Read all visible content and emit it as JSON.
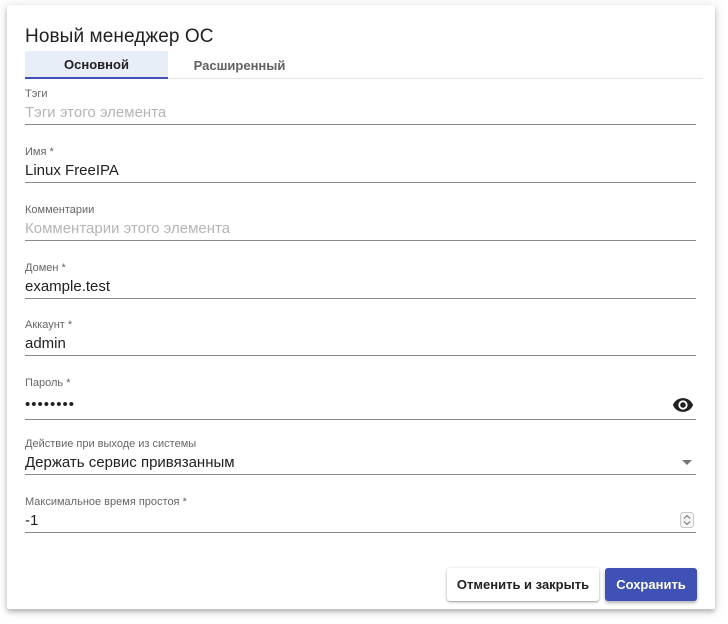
{
  "dialog": {
    "title": "Новый менеджер ОС"
  },
  "tabs": [
    {
      "label": "Основной",
      "active": true
    },
    {
      "label": "Расширенный",
      "active": false
    }
  ],
  "fields": {
    "tags": {
      "label": "Тэги",
      "value": "",
      "placeholder": "Тэги этого элемента"
    },
    "name": {
      "label": "Имя *",
      "value": "Linux FreeIPA"
    },
    "comments": {
      "label": "Комментарии",
      "value": "",
      "placeholder": "Комментарии этого элемента"
    },
    "domain": {
      "label": "Домен *",
      "value": "example.test"
    },
    "account": {
      "label": "Аккаунт *",
      "value": "admin"
    },
    "password": {
      "label": "Пароль *",
      "value": "••••••••"
    },
    "logout_action": {
      "label": "Действие при выходе из системы",
      "selected": "Держать сервис привязанным"
    },
    "max_idle": {
      "label": "Максимальное время простоя *",
      "value": "-1"
    }
  },
  "buttons": {
    "cancel_label": "Отменить и закрыть",
    "save_label": "Сохранить"
  },
  "colors": {
    "primary": "#3f51b5",
    "tab_active_bg": "#e8eef8"
  },
  "icons": {
    "password_toggle": "eye-icon",
    "select_caret": "caret-down-icon",
    "number_spinner": "spinner-icon"
  }
}
